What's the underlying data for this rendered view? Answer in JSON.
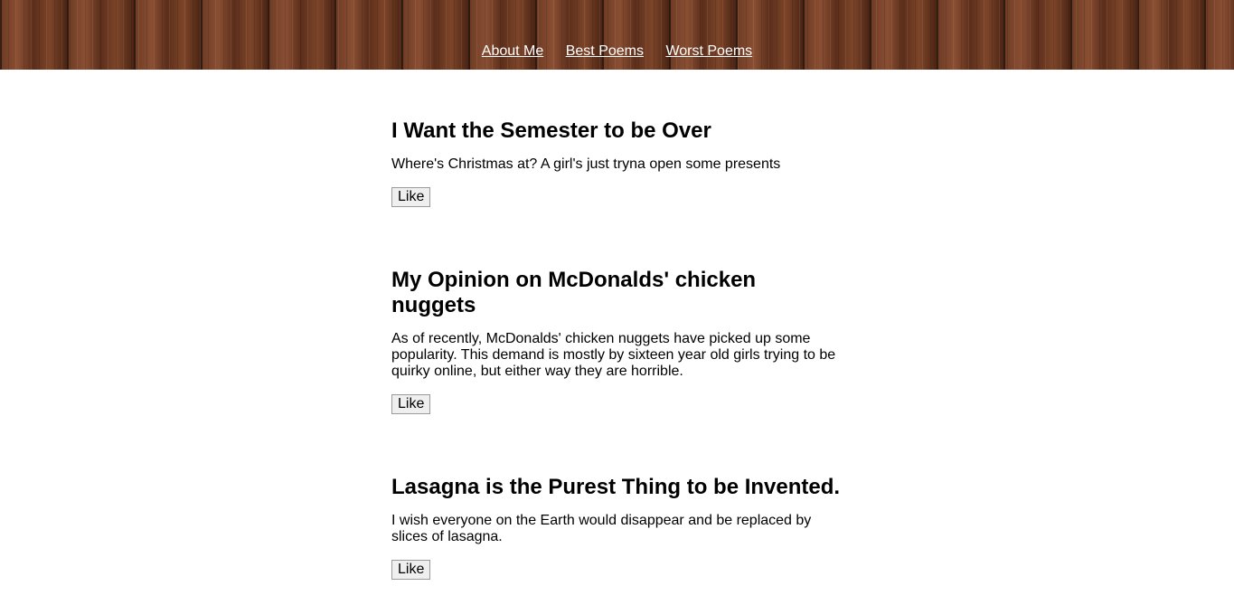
{
  "nav": {
    "links": [
      "About Me",
      "Best Poems",
      "Worst Poems"
    ]
  },
  "colors": {
    "nav_text": "#ffffff",
    "header_wood": "#5a2f1c",
    "page_background": "#ffffff"
  },
  "poems": [
    {
      "title": "I Want the Semester to be Over",
      "body": "Where's Christmas at? A girl's just tryna open some presents",
      "like_label": "Like"
    },
    {
      "title": "My Opinion on McDonalds' chicken nuggets",
      "body": "As of recently, McDonalds' chicken nuggets have picked up some popularity. This demand is mostly by sixteen year old girls trying to be quirky online, but either way they are horrible.",
      "like_label": "Like"
    },
    {
      "title": "Lasagna is the Purest Thing to be Invented.",
      "body": "I wish everyone on the Earth would disappear and be replaced by slices of lasagna.",
      "like_label": "Like"
    }
  ]
}
